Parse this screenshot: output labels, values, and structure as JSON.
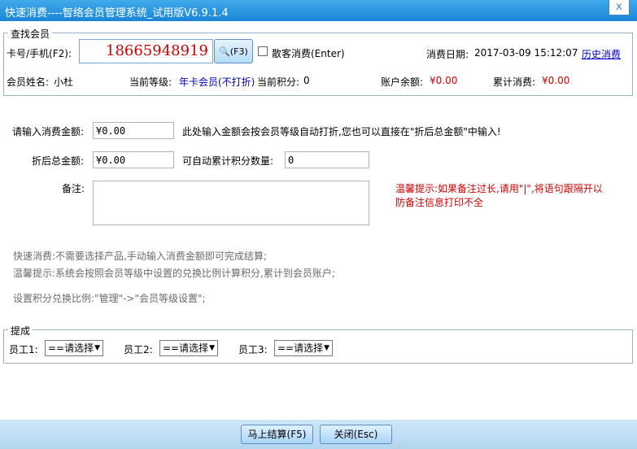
{
  "window": {
    "title": "快速消费----智络会员管理系统_试用版V6.9.1.4",
    "close_glyph": "x"
  },
  "search": {
    "group_label": "查找会员",
    "card_label": "卡号/手机(F2):",
    "card_value": "18665948919",
    "search_btn_label": "(F3)",
    "walkin_label": "散客消费(Enter)",
    "date_label": "消费日期:",
    "date_value": "2017-03-09 15:12:07",
    "history_link": "历史消费"
  },
  "member": {
    "name_label": "会员姓名:",
    "name_value": "小杜",
    "level_label": "当前等级:",
    "level_value": "年卡会员(不打折)",
    "points_label": "当前积分:",
    "points_value": "0",
    "balance_label": "账户余额:",
    "balance_value": "¥0.00",
    "total_label": "累计消费:",
    "total_value": "¥0.00"
  },
  "form": {
    "amount_label": "请输入消费金额:",
    "amount_value": "¥0.00",
    "amount_hint": "此处输入金额会按会员等级自动打折,您也可以直接在\"折后总金额\"中输入!",
    "discounted_label": "折后总金额:",
    "discounted_value": "¥0.00",
    "points_accum_label": "可自动累计积分数量:",
    "points_accum_value": "0",
    "remark_label": "备注:",
    "remark_value": "",
    "remark_tip": "温馨提示:如果备注过长,请用\"|\",将语句跟隔开以防备注信息打印不全"
  },
  "notes": {
    "line1": "快速消费:不需要选择产品,手动输入消费金额即可完成结算;",
    "line2": "温馨提示:系统会按照会员等级中设置的兑换比例计算积分,累计到会员账户;",
    "line3": "设置积分兑换比例:\"管理\"->\"会员等级设置\";"
  },
  "commission": {
    "group_label": "提成",
    "staff1_label": "员工1:",
    "staff1_value": "==请选择",
    "staff2_label": "员工2:",
    "staff2_value": "==请选择",
    "staff3_label": "员工3:",
    "staff3_value": "==请选择"
  },
  "actions": {
    "settle_label": "马上结算(F5)",
    "close_label": "关闭(Esc)"
  },
  "colors": {
    "title_bar": "#1a86d9",
    "money_red": "#cc0000",
    "level_blue": "#0000cc",
    "card_number_red": "#cc0000"
  }
}
